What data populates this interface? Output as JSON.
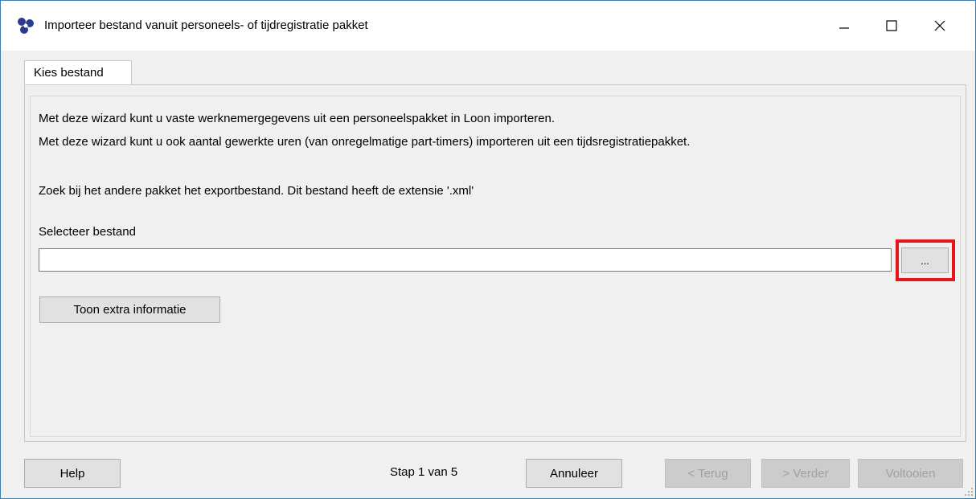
{
  "window": {
    "title": "Importeer bestand vanuit personeels- of tijdregistratie pakket",
    "icon": "app-logo-icon"
  },
  "tabs": [
    {
      "label": "Kies bestand",
      "active": true
    }
  ],
  "content": {
    "line1": "Met deze wizard kunt u vaste werknemergegevens uit een personeelspakket in Loon importeren.",
    "line2": "Met deze wizard kunt u ook aantal gewerkte uren (van onregelmatige part-timers) importeren uit een tijdsregistratiepakket.",
    "line3": "Zoek bij het andere pakket het exportbestand. Dit bestand heeft de extensie '.xml'",
    "file_label": "Selecteer bestand",
    "file_value": "",
    "browse_label": "...",
    "extra_info_label": "Toon extra informatie"
  },
  "footer": {
    "help_label": "Help",
    "step_label": "Stap  1 van  5",
    "cancel_label": "Annuleer",
    "back_label": "< Terug",
    "next_label": "> Verder",
    "finish_label": "Voltooien"
  },
  "colors": {
    "highlight": "#e8141c",
    "logo": "#2b3a8c",
    "window_border": "#3c7fb1"
  }
}
